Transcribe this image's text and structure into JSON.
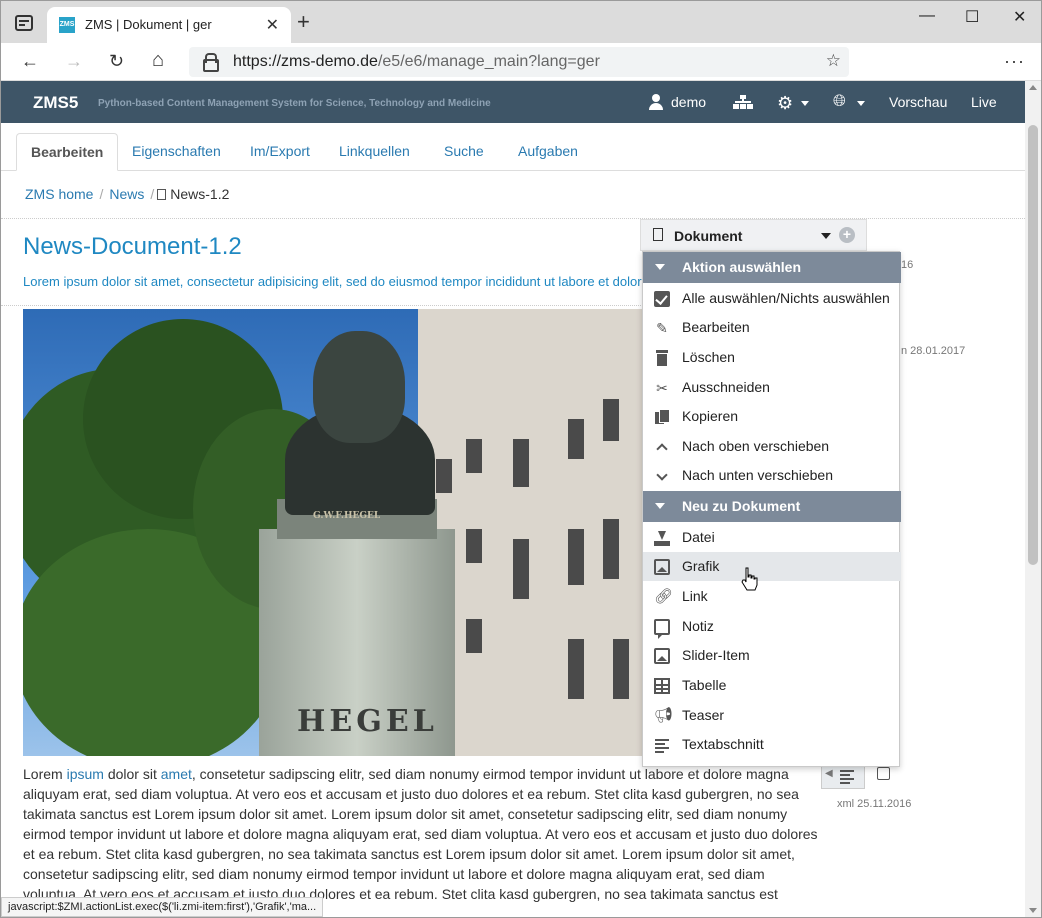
{
  "browser": {
    "tab_title": "ZMS | Dokument | ger",
    "favicon_text": "ZMS",
    "url_host": "https://zms-demo.de",
    "url_path": "/e5/e6/manage_main?lang=ger",
    "close": "✕",
    "new_tab": "+",
    "back": "←",
    "forward": "→",
    "reload": "↻",
    "home": "⌂",
    "more": "···",
    "minimize": "—",
    "maximize": "☐",
    "win_close": "✕",
    "favorite": "☆"
  },
  "header": {
    "logo": "ZMS5",
    "subtitle": "Python-based Content Management System for Science, Technology and Medicine",
    "user": "demo",
    "preview": "Vorschau",
    "live": "Live",
    "background": "#3e5567"
  },
  "tabs": [
    {
      "label": "Bearbeiten"
    },
    {
      "label": "Eigenschaften"
    },
    {
      "label": "Im/Export"
    },
    {
      "label": "Linkquellen"
    },
    {
      "label": "Suche"
    },
    {
      "label": "Aufgaben"
    }
  ],
  "breadcrumb": {
    "home": "ZMS home",
    "news": "News",
    "current": "News-1.2"
  },
  "content": {
    "title": "News-Document-1.2",
    "lead": "Lorem ipsum dolor sit amet, consectetur adipisicing elit, sed do eiusmod tempor incididunt ut labore et dolor",
    "engraving": "G.W.F.HEGEL",
    "pedestal_text": "HEGEL",
    "body_start": "Lorem ",
    "body_link1": "ipsum",
    "body_mid": " dolor sit ",
    "body_link2": "amet",
    "body_rest": ", consetetur sadipscing elitr, sed diam nonumy eirmod tempor invidunt ut labore et dolore magna aliquyam erat, sed diam voluptua. At vero eos et accusam et justo duo dolores et ea rebum. Stet clita kasd gubergren, no sea takimata sanctus est Lorem ipsum dolor sit amet. Lorem ipsum dolor sit amet, consetetur sadipscing elitr, sed diam nonumy eirmod tempor invidunt ut labore et dolore magna aliquyam erat, sed diam voluptua. At vero eos et accusam et justo duo dolores et ea rebum. Stet clita kasd gubergren, no sea takimata sanctus est Lorem ipsum dolor sit amet. Lorem ipsum dolor sit amet, consetetur sadipscing elitr, sed diam nonumy eirmod tempor invidunt ut labore et dolore magna aliquyam erat, sed diam voluptua. At vero eos et accusam et justo duo dolores et ea rebum. Stet clita kasd gubergren, no sea takimata sanctus est Lorem"
  },
  "right_column": {
    "meta1": "16",
    "meta2": "n 28.01.2017",
    "meta3": "xml 25.11.2016"
  },
  "doc_select": {
    "label": "Dokument",
    "plus": "+"
  },
  "menu": {
    "section1": "Aktion auswählen",
    "actions": [
      {
        "label": "Alle auswählen/Nichts auswählen",
        "icon": "check-square-icon"
      },
      {
        "label": "Bearbeiten",
        "icon": "pencil-icon"
      },
      {
        "label": "Löschen",
        "icon": "trash-icon"
      },
      {
        "label": "Ausschneiden",
        "icon": "scissors-icon"
      },
      {
        "label": "Kopieren",
        "icon": "copy-icon"
      },
      {
        "label": "Nach oben verschieben",
        "icon": "chevron-up-icon"
      },
      {
        "label": "Nach unten verschieben",
        "icon": "chevron-down-icon"
      }
    ],
    "section2": "Neu zu Dokument",
    "new_items": [
      {
        "label": "Datei",
        "icon": "download-icon"
      },
      {
        "label": "Grafik",
        "icon": "image-icon"
      },
      {
        "label": "Link",
        "icon": "link-icon"
      },
      {
        "label": "Notiz",
        "icon": "comment-icon"
      },
      {
        "label": "Slider-Item",
        "icon": "image-icon"
      },
      {
        "label": "Tabelle",
        "icon": "table-icon"
      },
      {
        "label": "Teaser",
        "icon": "bullhorn-icon"
      },
      {
        "label": "Textabschnitt",
        "icon": "align-left-icon"
      }
    ],
    "header_color": "#7d8a9a"
  },
  "status_bar": "javascript:$ZMI.actionList.exec($('li.zmi-item:first'),'Grafik','ma..."
}
